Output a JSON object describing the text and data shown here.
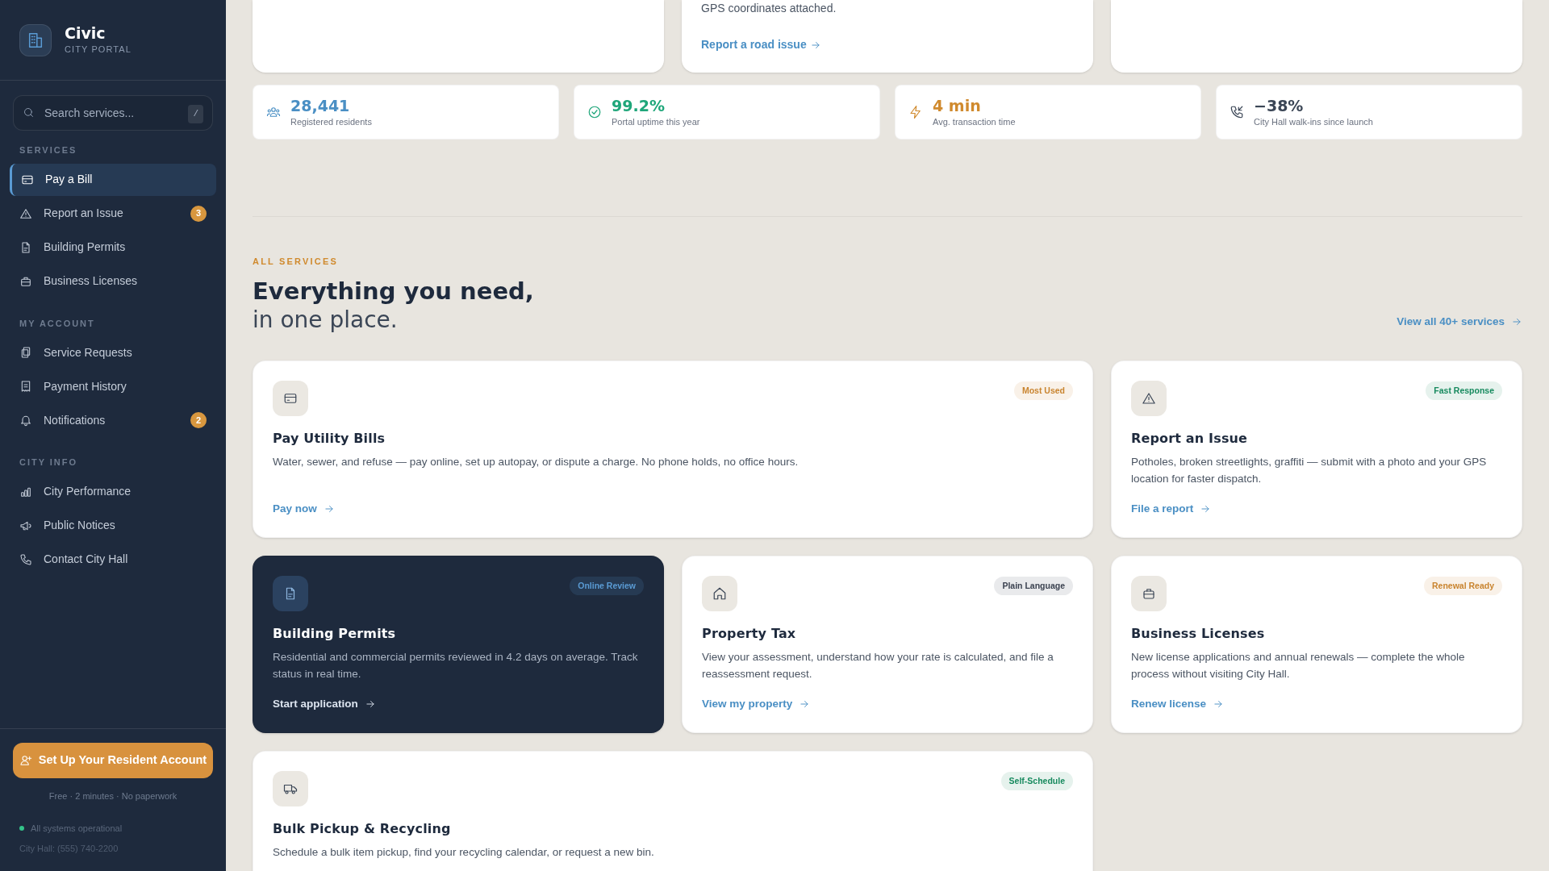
{
  "sidebar": {
    "brand": {
      "name": "Civic",
      "subtitle": "CITY PORTAL"
    },
    "search": {
      "placeholder": "Search services...",
      "shortcut": "/"
    },
    "sections": [
      {
        "title": "SERVICES",
        "items": [
          {
            "label": "Pay a Bill",
            "selected": true
          },
          {
            "label": "Report an Issue",
            "badge": "3",
            "selected": false
          },
          {
            "label": "Building Permits",
            "selected": false
          },
          {
            "label": "Business Licenses",
            "selected": false
          }
        ]
      },
      {
        "title": "MY ACCOUNT",
        "items": [
          {
            "label": "Service Requests",
            "selected": false
          },
          {
            "label": "Payment History",
            "selected": false
          },
          {
            "label": "Notifications",
            "badge": "2",
            "selected": false
          }
        ]
      },
      {
        "title": "CITY INFO",
        "items": [
          {
            "label": "City Performance",
            "selected": false
          },
          {
            "label": "Public Notices",
            "selected": false
          },
          {
            "label": "Contact City Hall",
            "selected": false
          }
        ]
      }
    ],
    "cta": {
      "label": "Set Up Your Resident Account",
      "note": "Free · 2 minutes · No paperwork"
    },
    "status": {
      "text": "All systems operational",
      "phone": "City Hall: (555) 740-2200"
    }
  },
  "top_row": {
    "middle_card": {
      "description": "GPS coordinates attached.",
      "link": "Report a road issue"
    }
  },
  "stats": [
    {
      "value": "28,441",
      "label": "Registered residents",
      "color": "#4a8fc4"
    },
    {
      "value": "99.2%",
      "label": "Portal uptime this year",
      "color": "#1fa67a"
    },
    {
      "value": "4 min",
      "label": "Avg. transaction time",
      "color": "#d08a2e"
    },
    {
      "value": "−38%",
      "label": "City Hall walk-ins since launch",
      "color": "#3b4656"
    }
  ],
  "all_services": {
    "eyebrow": "ALL SERVICES",
    "heading": "Everything you need,",
    "subheading": "in one place.",
    "view_all": "View all 40+ services",
    "cards": [
      {
        "kind": "wide",
        "title": "Pay Utility Bills",
        "description": "Water, sewer, and refuse — pay online, set up autopay, or dispute a charge. No phone holds, no office hours.",
        "link": "Pay now",
        "tag": "Most Used",
        "color": "#c9842f"
      },
      {
        "kind": "standard",
        "title": "Report an Issue",
        "description": "Potholes, broken streetlights, graffiti — submit with a photo and your GPS location for faster dispatch.",
        "link": "File a report",
        "tag": "Fast Response",
        "color": "#178a5e"
      },
      {
        "kind": "featured",
        "title": "Building Permits",
        "description": "Residential and commercial permits reviewed in 4.2 days on average. Track status in real time.",
        "link": "Start application",
        "tag": "Online Review",
        "color": "#5a9bd4"
      },
      {
        "kind": "standard",
        "title": "Property Tax",
        "description": "View your assessment, understand how your rate is calculated, and file a reassessment request.",
        "link": "View my property",
        "tag": "Plain Language",
        "color": "#3b4250"
      },
      {
        "kind": "standard",
        "title": "Business Licenses",
        "description": "New license applications and annual renewals — complete the whole process without visiting City Hall.",
        "link": "Renew license",
        "tag": "Renewal Ready",
        "color": "#c9842f"
      },
      {
        "kind": "wide",
        "title": "Bulk Pickup & Recycling",
        "description": "Schedule a bulk item pickup, find your recycling calendar, or request a new bin.",
        "tag": "Self-Schedule",
        "color": "#178a5e"
      }
    ]
  }
}
